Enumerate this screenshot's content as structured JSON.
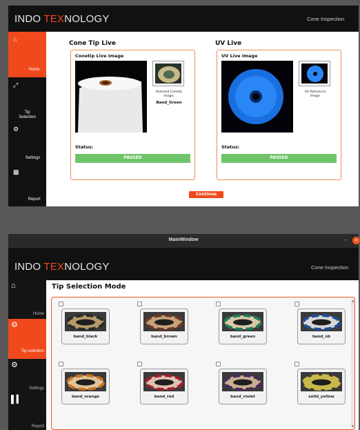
{
  "brand": {
    "part1": "INDO ",
    "part2": "TEX",
    "part3": "NOLOGY"
  },
  "colors": {
    "accent": "#f04a1c",
    "passed": "#6fc46a",
    "dark": "#111111"
  },
  "screen1": {
    "app_title": "Cone Inspection",
    "sidebar": [
      {
        "label": "Home",
        "icon": "home-icon",
        "active": true
      },
      {
        "label": "Tip\nSelection",
        "icon": "expand-icon",
        "active": false
      },
      {
        "label": "Settings",
        "icon": "gear-icon",
        "active": false
      },
      {
        "label": "Report",
        "icon": "report-icon",
        "active": false
      }
    ],
    "cone": {
      "section_title": "Cone Tip Live",
      "card_title": "Conetip Live Image",
      "ref_caption": "Selected Conetip\nImage:",
      "ref_value": "Band_Green",
      "status_label": "Status:",
      "status_value": "PASSED"
    },
    "uv": {
      "section_title": "UV Live",
      "card_title": "UV Live Image",
      "ref_caption": "UV Reference\nImage",
      "status_label": "Status:",
      "status_value": "PASSED"
    },
    "continue_label": "Continue"
  },
  "screen2": {
    "window_title": "MainWindow",
    "app_title": "Cone Inspection",
    "sidebar": [
      {
        "label": "Home",
        "icon": "home-icon",
        "active": false
      },
      {
        "label": "Tip selection",
        "icon": "gears-icon",
        "active": true
      },
      {
        "label": "Settings",
        "icon": "gear-icon",
        "active": false
      },
      {
        "label": "Report",
        "icon": "bar-chart-icon",
        "active": false
      }
    ],
    "page_title": "Tip Selection Mode",
    "tiles": [
      {
        "label": "band_black",
        "colors": [
          "#2a2a2a",
          "#b89a6a"
        ]
      },
      {
        "label": "band_brown",
        "colors": [
          "#6b3a22",
          "#c9a27a"
        ]
      },
      {
        "label": "band_green",
        "colors": [
          "#1f7a55",
          "#d8c9a8"
        ]
      },
      {
        "label": "band_nb",
        "colors": [
          "#1d4f9a",
          "#d8d8d8"
        ]
      },
      {
        "label": "band_orange",
        "colors": [
          "#c9731f",
          "#e0c49a"
        ]
      },
      {
        "label": "band_red",
        "colors": [
          "#a51c2a",
          "#e0c0b0"
        ]
      },
      {
        "label": "band_violet",
        "colors": [
          "#4a2a5a",
          "#c8b090"
        ]
      },
      {
        "label": "solid_yellow",
        "colors": [
          "#c8b84a",
          "#c8b84a"
        ]
      }
    ]
  }
}
